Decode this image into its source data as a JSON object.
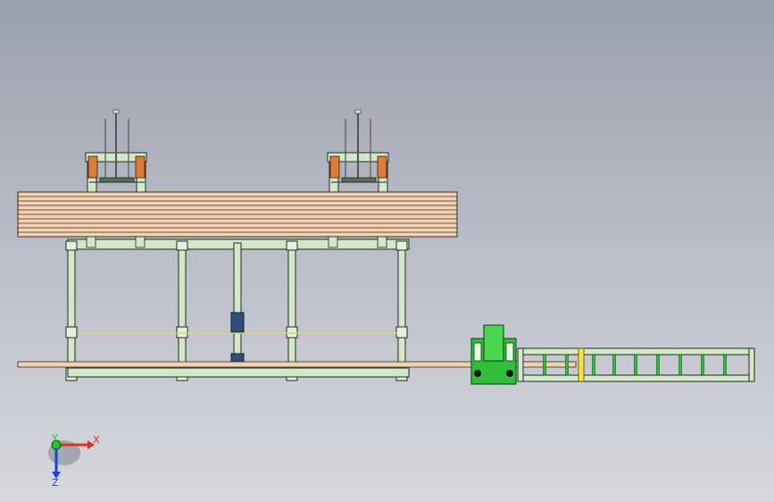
{
  "triad": {
    "x_label": "X",
    "y_label": "Y",
    "z_label": "Z"
  },
  "colors": {
    "background_top": "#9ba0ad",
    "background_bottom": "#d6d8dd",
    "frame_fill": "#d3e8c8",
    "frame_line": "#1f2a1f",
    "board_fill": "#f2d2b3",
    "board_line": "#3a2a1c",
    "accent_green": "#2fbf3c",
    "accent_orange": "#e07a3a",
    "cylinder_blue": "#2f4f7a",
    "yellow_line": "#d8d86a",
    "axis_x": "#e03020",
    "axis_y": "#20c030",
    "axis_z": "#2040e0"
  }
}
